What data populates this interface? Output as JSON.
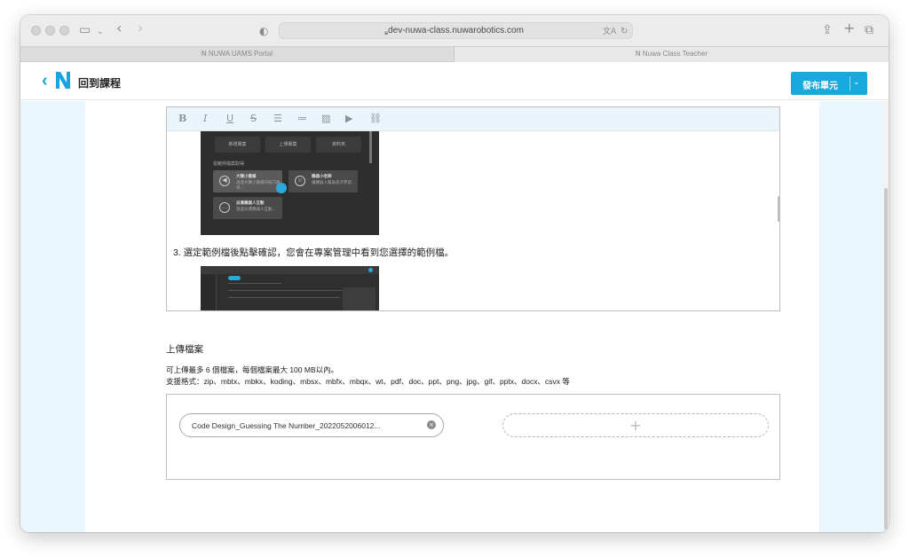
{
  "browser": {
    "url": "dev-nuwa-class.nuwarobotics.com",
    "tabs": [
      {
        "label": "NUWA UAMS Portal",
        "active": false
      },
      {
        "label": "Nuwa Class Teacher",
        "active": true
      }
    ],
    "icons": [
      "sidebar-icon",
      "chevron-down-icon",
      "back-icon",
      "forward-icon",
      "shield-icon",
      "lock-icon",
      "translate-icon",
      "reload-icon",
      "share-icon",
      "new-tab-icon",
      "tabs-overview-icon"
    ]
  },
  "header": {
    "back_label": "回到課程",
    "publish_label": "發布單元",
    "brand_color": "#17a9dc"
  },
  "editor": {
    "toolbar": [
      "B",
      "I",
      "U",
      "S",
      "indent",
      "list",
      "image",
      "video",
      "link"
    ],
    "screenshot1": {
      "tiles": [
        "新增專案",
        "上傳專案",
        "資料夾"
      ],
      "section_label": "從範例檔案取得",
      "cards": [
        {
          "title": "大聲小蜜蜂",
          "desc": "透過大聲小蜜蜂的技巧教導..."
        },
        {
          "title": "機器小老師",
          "desc": "讓機器人幫助孩子學習..."
        },
        {
          "title": "派遣機器人互動",
          "desc": "透過派遣機器人互動..."
        }
      ]
    },
    "step3_text": "3. 選定範例檔後點擊確認，您會在專案管理中看到您選擇的範例檔。"
  },
  "upload": {
    "title": "上傳檔案",
    "desc_line1": "可上傳最多 6 個檔案，每個檔案最大 100 MB以內。",
    "desc_line2": "支援格式：zip、mbtx、mbkx、koding、mbsx、mbfx、mbqx、wt、pdf、doc、ppt、png、jpg、gif、pptx、docx、csvx 等",
    "file_name": "Code Design_Guessing The Number_2022052006012...",
    "add_symbol": "+"
  }
}
